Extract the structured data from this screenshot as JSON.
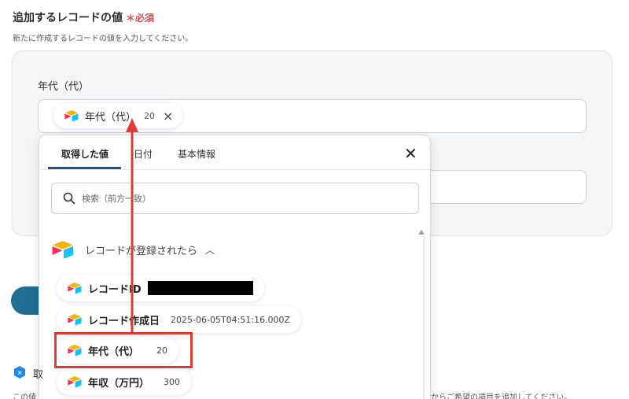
{
  "section": {
    "title": "追加するレコードの値",
    "required": "＊必須",
    "description": "新たに作成するレコードの値を入力してください。"
  },
  "field": {
    "label": "年代（代）",
    "chip": {
      "name": "年代（代）",
      "value": "20",
      "remove": "×"
    }
  },
  "dropdown": {
    "tabs": [
      {
        "label": "取得した値"
      },
      {
        "label": "日付"
      },
      {
        "label": "基本情報"
      }
    ],
    "close": "✕",
    "search_placeholder": "検索（前方一致）",
    "group": {
      "label": "レコードが登録されたら",
      "chevron": "︿"
    },
    "items": [
      {
        "name": "レコードID",
        "value": ""
      },
      {
        "name": "レコード作成日",
        "value": "2025-06-05T04:51:16.000Z"
      },
      {
        "name": "年代（代）",
        "value": "20"
      },
      {
        "name": "年収（万円）",
        "value": "300"
      }
    ]
  },
  "footer": {
    "help_char": "取",
    "left_text": "この値",
    "right_text": "からご希望の項目を追加してください。"
  },
  "colors": {
    "accent": "#1f6f93",
    "highlight": "#e53935",
    "required": "#e5484d"
  },
  "icons": [
    "airtable-logo-icon",
    "search-icon",
    "close-icon",
    "chevron-up-icon",
    "help-icon"
  ]
}
